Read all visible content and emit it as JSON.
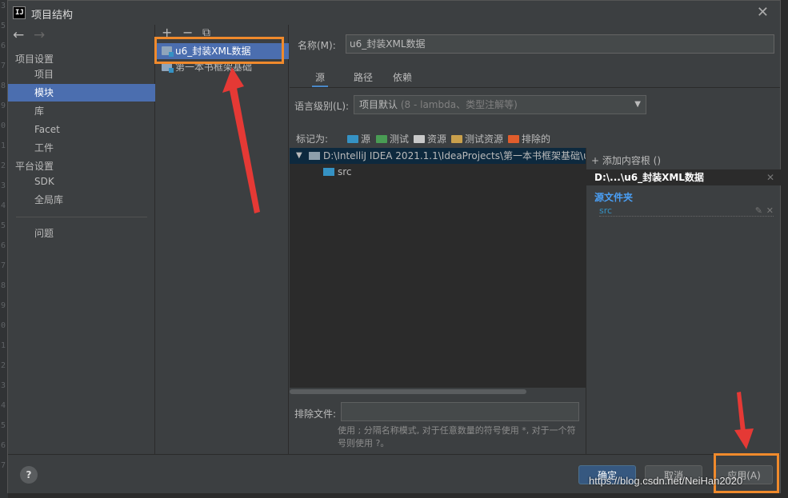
{
  "gutter_lines": [
    "3",
    "5",
    "6",
    "7",
    "8",
    "9",
    "0",
    "1",
    "2",
    "3",
    "4",
    "5",
    "6",
    "7",
    "8",
    "9",
    "0",
    "1",
    "2",
    "3",
    "4",
    "5",
    "6",
    "7"
  ],
  "window": {
    "title": "项目结构",
    "app_icon_text": "IJ"
  },
  "nav": {
    "project_settings_header": "项目设置",
    "project_settings_items": [
      "项目",
      "模块",
      "库",
      "Facet",
      "工件"
    ],
    "platform_settings_header": "平台设置",
    "platform_settings_items": [
      "SDK",
      "全局库"
    ],
    "problems": "问题"
  },
  "module_toolbar": {
    "add": "+",
    "remove": "−",
    "copy": "⧉"
  },
  "modules": [
    "u6_封装XML数据",
    "第一本书框架基础"
  ],
  "name_field": {
    "label": "名称(M):",
    "value": "u6_封装XML数据"
  },
  "tabs": [
    "源",
    "路径",
    "依赖"
  ],
  "language_level": {
    "label": "语言级别(L):",
    "value": "项目默认",
    "detail": " (8 - lambda、类型注解等)"
  },
  "mark_as": {
    "label": "标记为:",
    "items": [
      {
        "label": "源",
        "color": "#3592c4"
      },
      {
        "label": "测试",
        "color": "#499c54"
      },
      {
        "label": "资源",
        "color": "#c9c9c9"
      },
      {
        "label": "测试资源",
        "color": "#c9a04c"
      },
      {
        "label": "排除的",
        "color": "#e05d2c"
      }
    ]
  },
  "tree": {
    "root": "D:\\IntelliJ IDEA 2021.1.1\\IdeaProjects\\第一本书框架基础\\u",
    "child": "src"
  },
  "exclude": {
    "label": "排除文件:",
    "hint": "使用 ; 分隔名称模式, 对于任意数量的符号使用 *, 对于一个符号则使用 ?。"
  },
  "content_roots": {
    "add_label": "+ 添加内容根 ()",
    "path": "D:\\...\\u6_封装XML数据",
    "source_folders_title": "源文件夹",
    "source_entry": "src"
  },
  "buttons": {
    "help": "?",
    "ok": "确定",
    "cancel": "取消",
    "apply": "应用(A)"
  },
  "watermark": "https://blog.csdn.net/NeiHan2020",
  "colors": {
    "selection": "#4b6eaf",
    "highlight_box": "#f08a2c",
    "arrow": "#e53935"
  }
}
